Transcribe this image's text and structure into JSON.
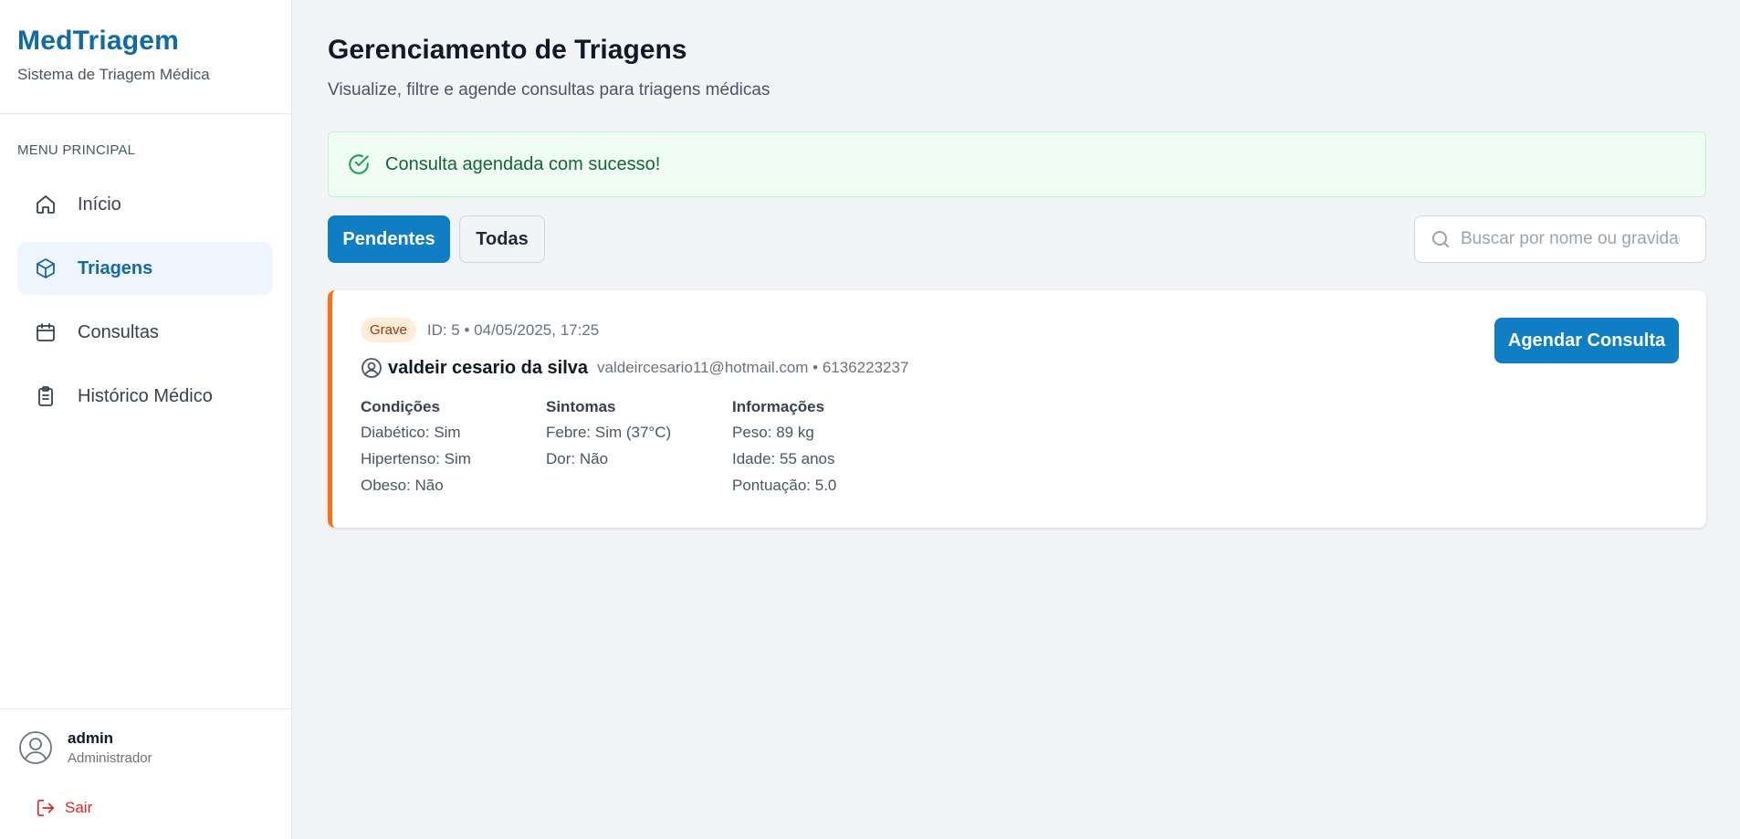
{
  "brand": {
    "title": "MedTriagem",
    "subtitle": "Sistema de Triagem Médica"
  },
  "sidebar": {
    "heading": "MENU PRINCIPAL",
    "items": [
      {
        "label": "Início",
        "icon": "home-icon",
        "active": false
      },
      {
        "label": "Triagens",
        "icon": "cube-icon",
        "active": true
      },
      {
        "label": "Consultas",
        "icon": "calendar-icon",
        "active": false
      },
      {
        "label": "Histórico Médico",
        "icon": "clipboard-icon",
        "active": false
      }
    ],
    "user": {
      "name": "admin",
      "role": "Administrador"
    },
    "logout_label": "Sair"
  },
  "page": {
    "title": "Gerenciamento de Triagens",
    "subtitle": "Visualize, filtre e agende consultas para triagens médicas"
  },
  "alert": {
    "message": "Consulta agendada com sucesso!",
    "type": "success"
  },
  "tabs": [
    {
      "label": "Pendentes",
      "selected": true
    },
    {
      "label": "Todas",
      "selected": false
    }
  ],
  "search": {
    "placeholder": "Buscar por nome ou gravidade",
    "value": ""
  },
  "triage": {
    "severity": "Grave",
    "meta": "ID: 5 • 04/05/2025, 17:25",
    "patient_name": "valdeir cesario da silva",
    "contact": "valdeircesario11@hotmail.com • 6136223237",
    "action_label": "Agendar Consulta",
    "conditions": {
      "title": "Condições",
      "lines": [
        "Diabético: Sim",
        "Hipertenso: Sim",
        "Obeso: Não"
      ]
    },
    "symptoms": {
      "title": "Sintomas",
      "lines": [
        "Febre: Sim (37°C)",
        "Dor: Não"
      ]
    },
    "info": {
      "title": "Informações",
      "lines": [
        "Peso: 89 kg",
        "Idade: 55 anos",
        "Pontuação: 5.0"
      ]
    }
  },
  "colors": {
    "brand": "#0f6aa6",
    "primary_button": "#0f7ec4",
    "severity_accent": "#f97316",
    "logout": "#dc2626",
    "success": "#16a34a"
  }
}
